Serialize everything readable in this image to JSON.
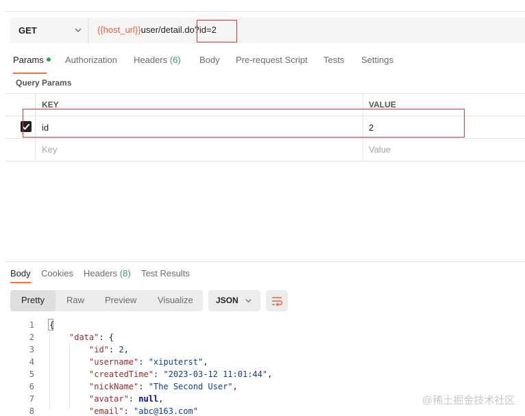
{
  "request": {
    "method": "GET",
    "url_variable": "{{host_url}}",
    "url_path": "user/detail.do?",
    "url_query": "id=2"
  },
  "request_tabs": [
    {
      "label": "Params",
      "count": "",
      "active": true,
      "indicator": "green-dot"
    },
    {
      "label": "Authorization",
      "count": ""
    },
    {
      "label": "Headers",
      "count": "(6)"
    },
    {
      "label": "Body",
      "count": ""
    },
    {
      "label": "Pre-request Script",
      "count": ""
    },
    {
      "label": "Tests",
      "count": ""
    },
    {
      "label": "Settings",
      "count": ""
    }
  ],
  "params": {
    "section_title": "Query Params",
    "columns": [
      "KEY",
      "VALUE"
    ],
    "rows": [
      {
        "checked": true,
        "key": "id",
        "value": "2"
      }
    ],
    "new_row": {
      "key_placeholder": "Key",
      "value_placeholder": "Value"
    }
  },
  "response_tabs": [
    {
      "label": "Body",
      "count": "",
      "active": true
    },
    {
      "label": "Cookies",
      "count": ""
    },
    {
      "label": "Headers",
      "count": "(8)"
    },
    {
      "label": "Test Results",
      "count": ""
    }
  ],
  "view_modes": [
    "Pretty",
    "Raw",
    "Preview",
    "Visualize"
  ],
  "active_view_mode": "Pretty",
  "format": "JSON",
  "code_lines": [
    {
      "n": "1",
      "text": "{"
    },
    {
      "n": "2",
      "key": "\"data\"",
      "rest": ": {"
    },
    {
      "n": "3",
      "key": "\"id\"",
      "num": "2",
      "tail": ","
    },
    {
      "n": "4",
      "key": "\"username\"",
      "str": "\"xiputerst\"",
      "tail": ","
    },
    {
      "n": "5",
      "key": "\"createdTime\"",
      "str": "\"2023-03-12 11:01:44\"",
      "tail": ","
    },
    {
      "n": "6",
      "key": "\"nickName\"",
      "str": "\"The Second User\"",
      "tail": ","
    },
    {
      "n": "7",
      "key": "\"avatar\"",
      "kw": "null",
      "tail": ","
    },
    {
      "n": "8",
      "key": "\"email\"",
      "str": "\"abc@163.com\"",
      "tail": ""
    }
  ],
  "watermark": "@稀土掘金技术社区",
  "colors": {
    "accent": "#ff6c37",
    "highlight_box": "#e2322f",
    "variable": "#e8613a",
    "active_dot": "#2ea44f"
  }
}
